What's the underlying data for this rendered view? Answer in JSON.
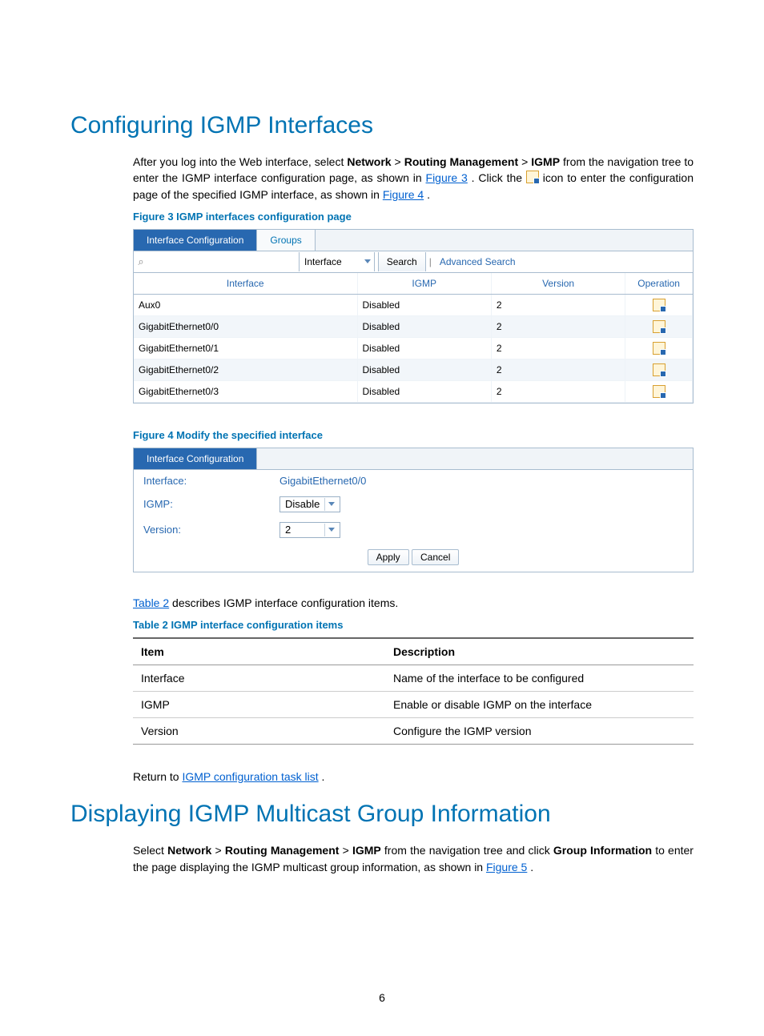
{
  "page_number": "6",
  "h1_a": "Configuring IGMP Interfaces",
  "intro_a": {
    "t1": "After you log into the Web interface, select ",
    "b1": "Network",
    "gt": " > ",
    "b2": "Routing Management",
    "b3": "IGMP",
    "t2": " from the navigation tree to enter the IGMP interface configuration page, as shown in ",
    "link_fig3": "Figure 3",
    "t3": ". Click the ",
    "t4": " icon to enter the configuration page of the specified IGMP interface, as shown in ",
    "link_fig4": "Figure 4",
    "t5": "."
  },
  "caption_fig3": "Figure 3 IGMP interfaces configuration page",
  "fig3": {
    "tabs": {
      "interface_conf": "Interface Configuration",
      "groups": "Groups"
    },
    "search": {
      "placeholder": "",
      "field_option": "Interface",
      "search_btn": "Search",
      "sep": "|",
      "adv": "Advanced Search"
    },
    "headers": {
      "interface": "Interface",
      "igmp": "IGMP",
      "version": "Version",
      "operation": "Operation"
    },
    "rows": [
      {
        "interface": "Aux0",
        "igmp": "Disabled",
        "version": "2"
      },
      {
        "interface": "GigabitEthernet0/0",
        "igmp": "Disabled",
        "version": "2"
      },
      {
        "interface": "GigabitEthernet0/1",
        "igmp": "Disabled",
        "version": "2"
      },
      {
        "interface": "GigabitEthernet0/2",
        "igmp": "Disabled",
        "version": "2"
      },
      {
        "interface": "GigabitEthernet0/3",
        "igmp": "Disabled",
        "version": "2"
      }
    ]
  },
  "caption_fig4": "Figure 4 Modify the specified interface",
  "fig4": {
    "tab": "Interface Configuration",
    "rows": {
      "iface_lbl": "Interface:",
      "iface_val": "GigabitEthernet0/0",
      "igmp_lbl": "IGMP:",
      "igmp_val": "Disable",
      "ver_lbl": "Version:",
      "ver_val": "2"
    },
    "apply": "Apply",
    "cancel": "Cancel"
  },
  "table2_intro": {
    "link_table2": "Table 2",
    "rest": " describes IGMP interface configuration items."
  },
  "caption_table2": "Table 2 IGMP interface configuration items",
  "table2": {
    "headers": {
      "item": "Item",
      "desc": "Description"
    },
    "rows": [
      {
        "item": "Interface",
        "desc": "Name of the interface to be configured"
      },
      {
        "item": "IGMP",
        "desc": "Enable or disable IGMP on the interface"
      },
      {
        "item": "Version",
        "desc": "Configure the IGMP version"
      }
    ]
  },
  "return_line": {
    "pre": "Return to ",
    "link": "IGMP configuration task list",
    "post": "."
  },
  "h1_b": "Displaying IGMP Multicast Group Information",
  "intro_b": {
    "t1": "Select ",
    "b1": "Network",
    "gt": " > ",
    "b2": "Routing Management",
    "b3": "IGMP",
    "t2": " from the navigation tree and click ",
    "b4": "Group Information",
    "t3": " to enter the page displaying the IGMP multicast group information, as shown in ",
    "link_fig5": "Figure 5",
    "t4": "."
  }
}
